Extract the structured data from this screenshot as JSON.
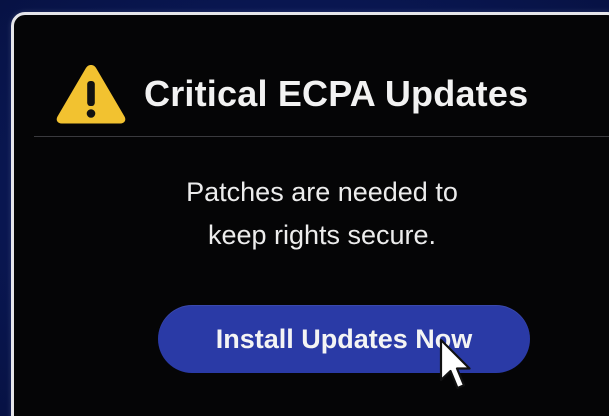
{
  "dialog": {
    "title": "Critical ECPA Updates",
    "message_line_1": "Patches are needed to",
    "message_line_2": "keep rights secure.",
    "install_button_label": "Install Updates Now"
  },
  "icons": {
    "warning": "warning-icon",
    "cursor": "mouse-pointer-icon"
  },
  "colors": {
    "background": "#0b1a5e",
    "dialog_background": "#050506",
    "dialog_border": "#e6e6ea",
    "warning_yellow": "#f2c230",
    "button": "#2a3aa6",
    "text": "#f2f2f2"
  }
}
